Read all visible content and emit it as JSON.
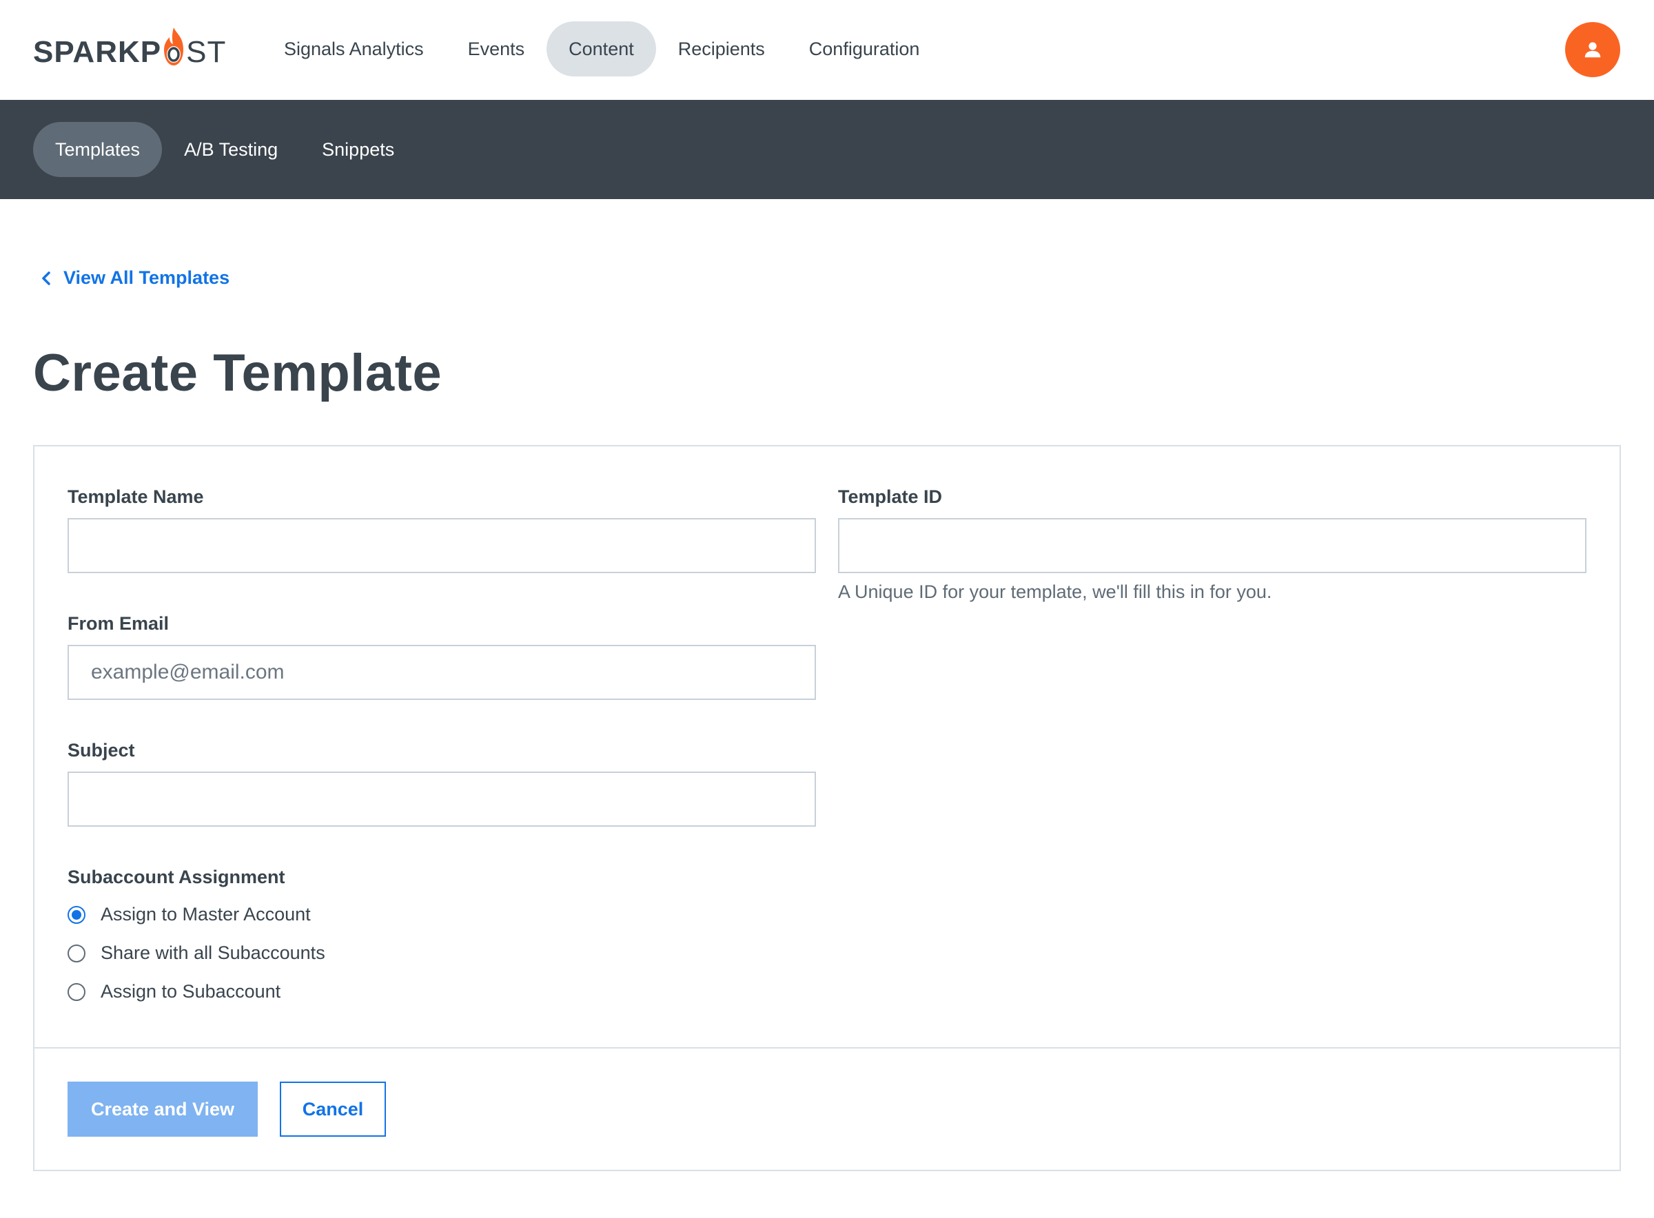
{
  "brand": {
    "logo_part1": "SPARKP",
    "logo_part2": "ST",
    "accent_color": "#fa6423",
    "link_color": "#1273e6",
    "subnav_background": "#3b444d"
  },
  "nav": {
    "items": [
      {
        "label": "Signals Analytics",
        "active": false
      },
      {
        "label": "Events",
        "active": false
      },
      {
        "label": "Content",
        "active": true
      },
      {
        "label": "Recipients",
        "active": false
      },
      {
        "label": "Configuration",
        "active": false
      }
    ],
    "avatar_icon": "user-icon"
  },
  "subnav": {
    "items": [
      {
        "label": "Templates",
        "active": true
      },
      {
        "label": "A/B Testing",
        "active": false
      },
      {
        "label": "Snippets",
        "active": false
      }
    ]
  },
  "breadcrumb": {
    "label": "View All Templates",
    "icon": "chevron-left-icon"
  },
  "page_title": "Create Template",
  "form": {
    "template_name": {
      "label": "Template Name",
      "value": "",
      "placeholder": ""
    },
    "template_id": {
      "label": "Template ID",
      "value": "",
      "placeholder": "",
      "help": "A Unique ID for your template, we'll fill this in for you."
    },
    "from_email": {
      "label": "From Email",
      "value": "",
      "placeholder": "example@email.com"
    },
    "subject": {
      "label": "Subject",
      "value": "",
      "placeholder": ""
    },
    "subaccount": {
      "label": "Subaccount Assignment",
      "options": [
        {
          "label": "Assign to Master Account",
          "checked": true
        },
        {
          "label": "Share with all Subaccounts",
          "checked": false
        },
        {
          "label": "Assign to Subaccount",
          "checked": false
        }
      ]
    }
  },
  "actions": {
    "create_label": "Create and View",
    "cancel_label": "Cancel"
  }
}
